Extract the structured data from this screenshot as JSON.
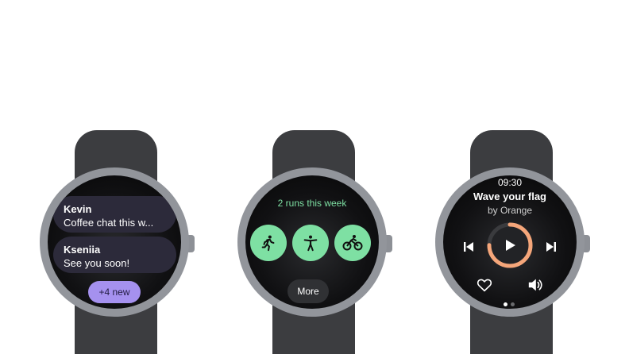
{
  "watch_messages": {
    "messages": [
      {
        "name": "Kevin",
        "text": "Coffee chat this w..."
      },
      {
        "name": "Kseniia",
        "text": "See you soon!"
      }
    ],
    "new_button": "+4 new"
  },
  "watch_fitness": {
    "title": "2 runs this week",
    "activities": [
      "run-icon",
      "workout-icon",
      "bike-icon"
    ],
    "more_button": "More",
    "accent": "#7ee0a3"
  },
  "watch_media": {
    "time": "09:30",
    "song": "Wave your flag",
    "artist": "by Orange",
    "progress": 0.75,
    "accent": "#f5a67a",
    "page_indicator": {
      "count": 2,
      "active": 0
    }
  }
}
